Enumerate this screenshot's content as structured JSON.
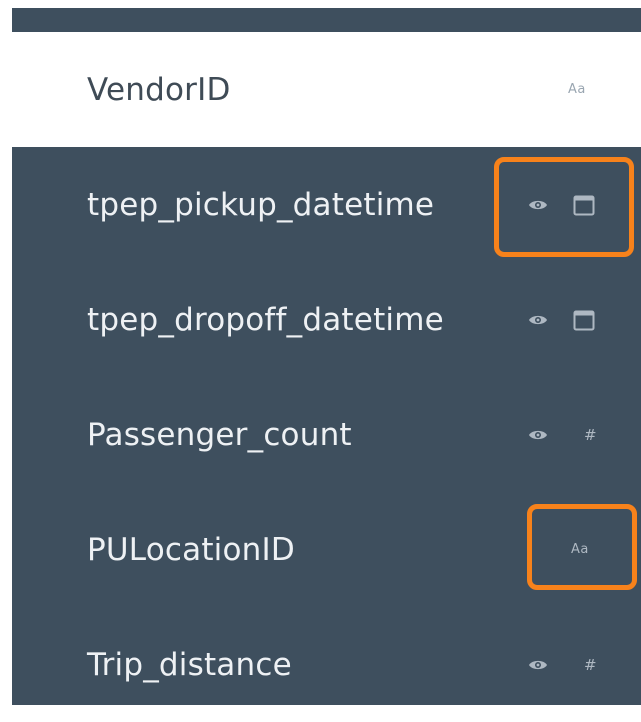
{
  "fields": [
    {
      "name": "VendorID",
      "type_icon": "text-type-icon",
      "type_label": "Aa",
      "visibility_icon": null,
      "selected": true
    },
    {
      "name": "tpep_pickup_datetime",
      "type_icon": "calendar-icon",
      "visibility_icon": "eye-icon",
      "selected": false
    },
    {
      "name": "tpep_dropoff_datetime",
      "type_icon": "calendar-icon",
      "visibility_icon": "eye-icon",
      "selected": false
    },
    {
      "name": "Passenger_count",
      "type_icon": "number-type-icon",
      "type_label": "#",
      "visibility_icon": "eye-icon",
      "selected": false
    },
    {
      "name": "PULocationID",
      "type_icon": "text-type-icon",
      "type_label": "Aa",
      "visibility_icon": null,
      "selected": false
    },
    {
      "name": "Trip_distance",
      "type_icon": "number-type-icon",
      "type_label": "#",
      "visibility_icon": "eye-icon",
      "selected": false
    }
  ],
  "colors": {
    "panel_bg": "#3e4f5e",
    "selected_bg": "#ffffff",
    "highlight": "#f7821b",
    "icon": "#aeb8c2"
  }
}
